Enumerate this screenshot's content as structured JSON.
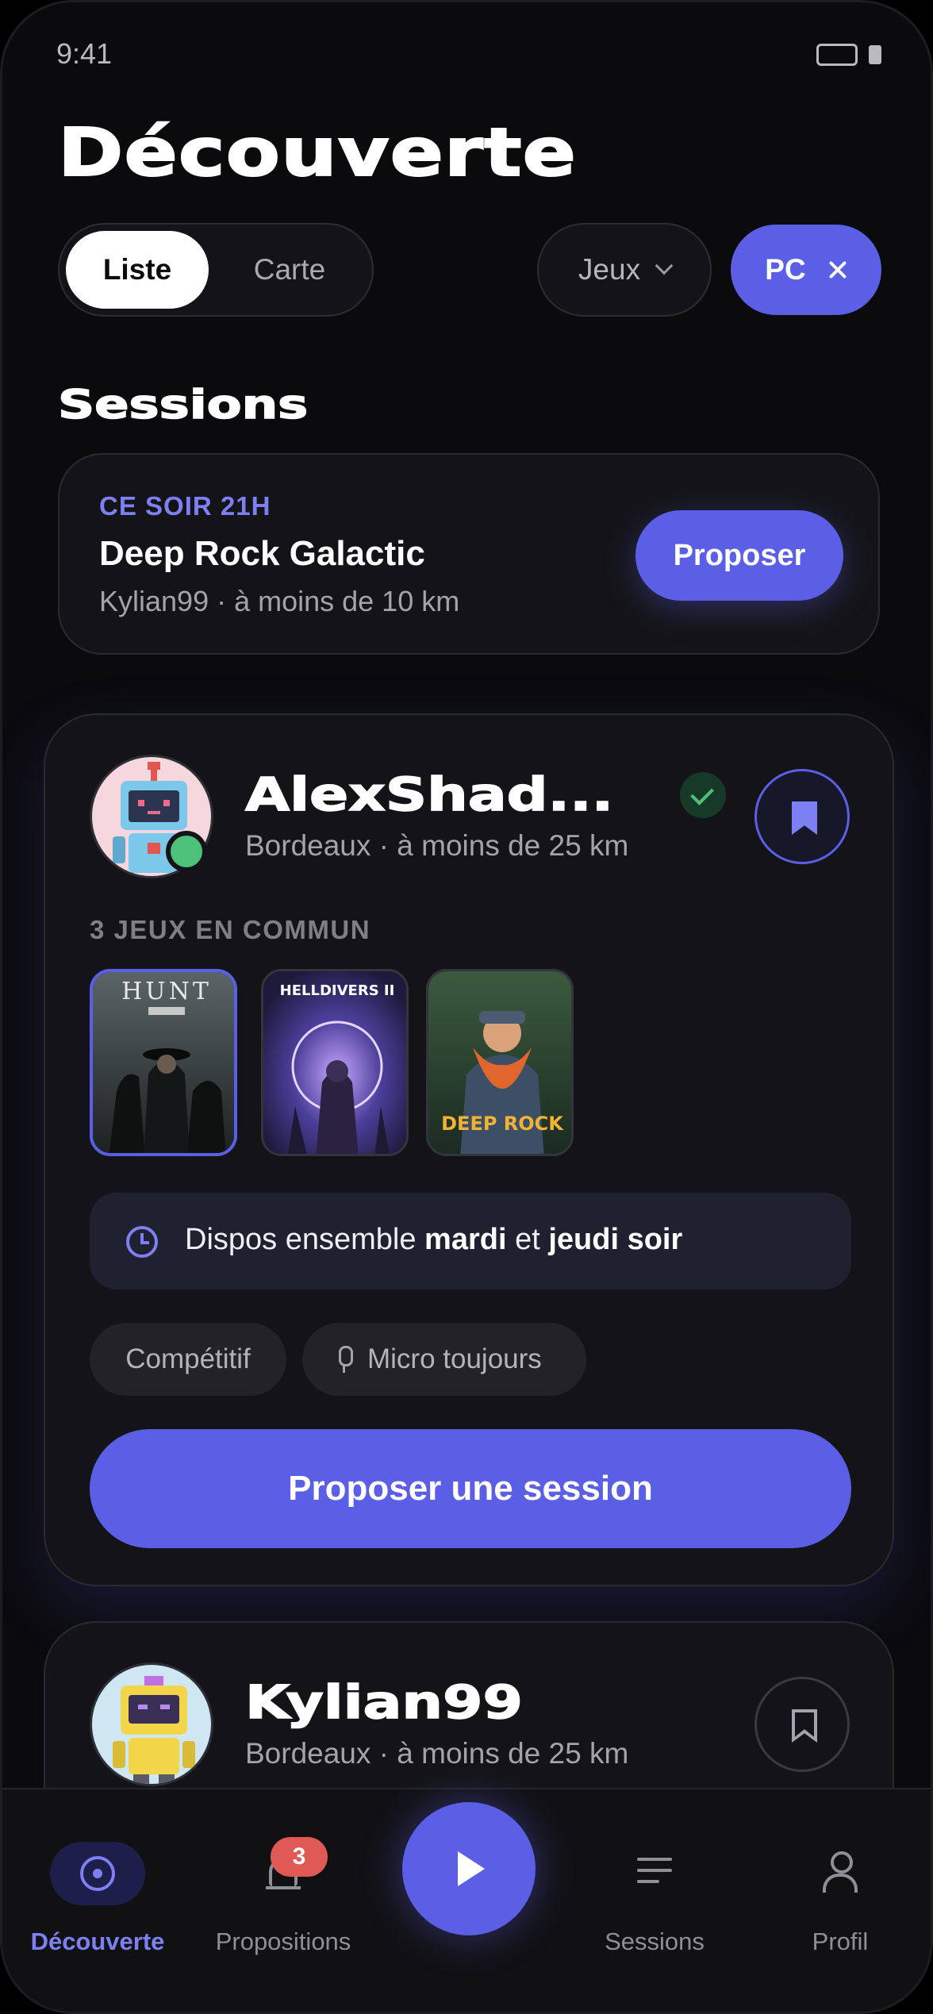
{
  "status": {
    "time": "9:41"
  },
  "page": {
    "title": "Découverte"
  },
  "view_toggle": {
    "active": "Liste",
    "inactive": "Carte"
  },
  "filters": {
    "category": "Jeux",
    "platform": "PC"
  },
  "sessions": {
    "title": "Sessions",
    "card": {
      "when": "CE SOIR 21H",
      "game": "Deep Rock Galactic",
      "subtitle": "Kylian99 · à moins de 10 km",
      "action": "Proposer"
    }
  },
  "profiles": [
    {
      "name": "AlexShad...",
      "location": "Bordeaux · à moins de 25 km",
      "common_games_label": "3 JEUX EN COMMUN",
      "games": [
        "HUNT: Showdown",
        "HELLDIVERS II",
        "Deep Rock Galactic"
      ],
      "availability": {
        "prefix": "Dispos ensemble ",
        "day1": "mardi",
        "joiner": " et ",
        "day2": "jeudi soir"
      },
      "tags": [
        "Compétitif",
        "Micro toujours"
      ],
      "cta": "Proposer une session"
    },
    {
      "name": "Kylian99",
      "location": "Bordeaux · à moins de 25 km"
    }
  ],
  "game_art": [
    "HUNT",
    "HELLDIVERS II",
    "DEEP ROCK"
  ],
  "nav": {
    "items": [
      "Découverte",
      "Propositions",
      "Sessions",
      "Profil"
    ],
    "badge": "3"
  },
  "colors": {
    "accent": "#5b5fe6",
    "background": "#0b0b0e",
    "card": "#141418",
    "online": "#4cc17a",
    "badge": "#e05a55"
  }
}
